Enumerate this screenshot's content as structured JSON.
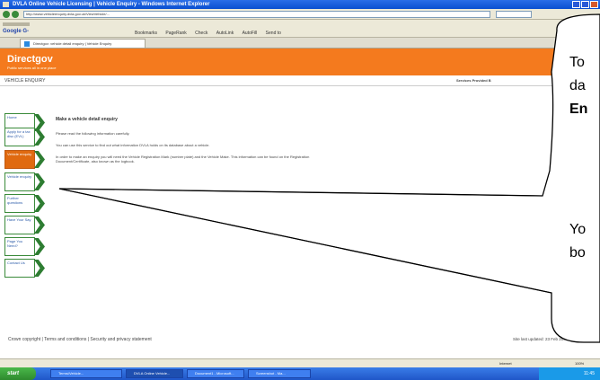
{
  "window": {
    "title": "DVLA Online Vehicle Licensing | Vehicle Enquiry - Windows Internet Explorer"
  },
  "address": {
    "url": "http://www.vehicleenquiry.dvla.gov.uk/ViewVehicle/..."
  },
  "toolbar": {
    "google_label": "Google G-",
    "items": [
      "Bookmarks",
      "PageRank",
      "Check",
      "AutoLink",
      "AutoFill",
      "Send to"
    ]
  },
  "tab": {
    "label": "Directgov: vehicle detail enquiry | Vehicle Enquiry"
  },
  "header": {
    "logo": "Directgov",
    "logo_sub": "Public services all in one place",
    "tagline": "Public services all in one place"
  },
  "crumb": {
    "section": "VEHICLE ENQUIRY",
    "provided_by": "Services Provided B"
  },
  "nav": {
    "items": [
      {
        "label": "Home"
      },
      {
        "label": "Apply for a tax disc (EVL)"
      },
      {
        "label": "Vehicle enquiry"
      },
      {
        "label": "Vehicle enquiry"
      },
      {
        "label": "Further questions"
      },
      {
        "label": "Have Your Say"
      },
      {
        "label": "Page You Need?"
      },
      {
        "label": "Contact Us"
      }
    ]
  },
  "content": {
    "heading": "Make a vehicle detail enquiry",
    "para1": "Please read the following information carefully.",
    "para2": "You can use this service to find out what information DVLA holds on its database about a vehicle.",
    "para3": "In order to make an enquiry you will need the Vehicle Registration Mark (number plate) and the Vehicle Make. This information can be found on the Registration Document/Certificate, also known as the logbook."
  },
  "footer": {
    "links": "Crown copyright  |  Terms and conditions  |  Security and privacy statement",
    "updated": "Site last updated: 23 Feb 2007"
  },
  "status": {
    "zone": "Internet",
    "zoom": "100%"
  },
  "taskbar": {
    "start": "start",
    "tasks": [
      "Terms\\Vehicle...",
      "DVLA Online Vehicle...",
      "Document1 - Microsoft...",
      "Screenshot - Ma..."
    ],
    "clock": "11:45"
  },
  "callout": {
    "line1": "To",
    "line2": "da",
    "line3": "En",
    "line4": "Yo",
    "line5": "bo"
  }
}
